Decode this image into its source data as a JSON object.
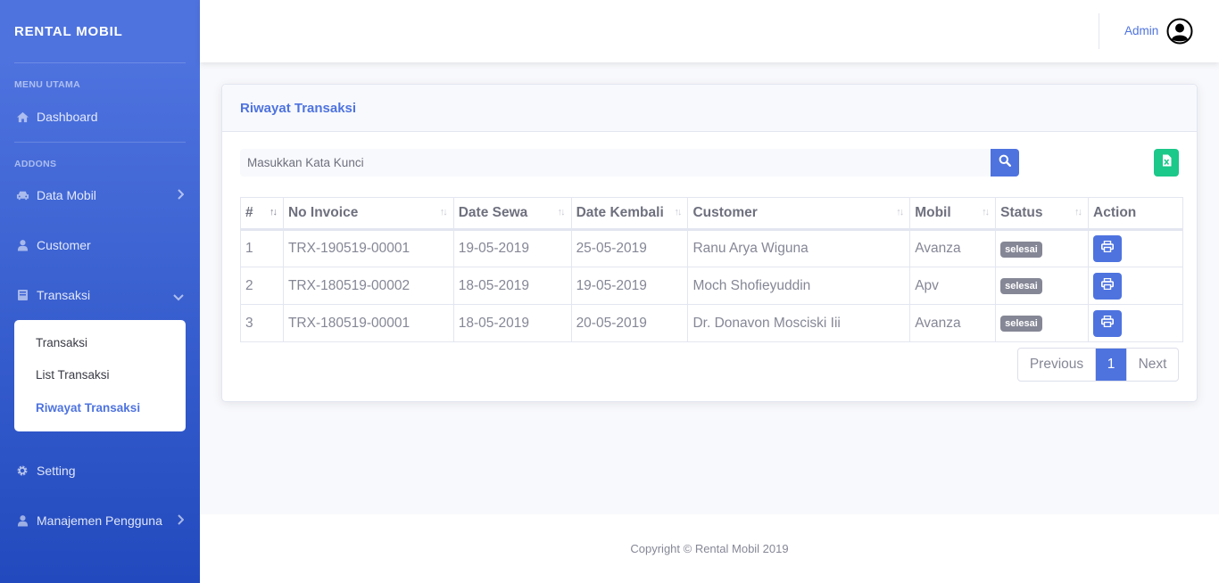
{
  "sidebar": {
    "brand": "RENTAL MOBIL",
    "heading_main": "MENU UTAMA",
    "heading_addons": "ADDONS",
    "items": {
      "dashboard": "Dashboard",
      "data_mobil": "Data Mobil",
      "customer": "Customer",
      "transaksi": "Transaksi",
      "setting": "Setting",
      "manajemen": "Manajemen Pengguna"
    },
    "submenu": [
      "Transaksi",
      "List Transaksi",
      "Riwayat Transaksi"
    ]
  },
  "topbar": {
    "username": "Admin"
  },
  "card": {
    "title": "Riwayat Transaksi",
    "search_placeholder": "Masukkan Kata Kunci"
  },
  "table": {
    "headers": [
      "#",
      "No Invoice",
      "Date Sewa",
      "Date Kembali",
      "Customer",
      "Mobil",
      "Status",
      "Action"
    ],
    "rows": [
      [
        "1",
        "TRX-190519-00001",
        "19-05-2019",
        "25-05-2019",
        "Ranu Arya Wiguna",
        "Avanza",
        "selesai"
      ],
      [
        "2",
        "TRX-180519-00002",
        "18-05-2019",
        "19-05-2019",
        "Moch Shofieyuddin",
        "Apv",
        "selesai"
      ],
      [
        "3",
        "TRX-180519-00001",
        "18-05-2019",
        "20-05-2019",
        "Dr. Donavon Mosciski Iii",
        "Avanza",
        "selesai"
      ]
    ]
  },
  "pagination": {
    "previous": "Previous",
    "page": "1",
    "next": "Next"
  },
  "footer": {
    "copyright": "Copyright © Rental Mobil 2019"
  },
  "colors": {
    "primary": "#4e73df",
    "success": "#1cc88a",
    "badge": "#858796"
  }
}
